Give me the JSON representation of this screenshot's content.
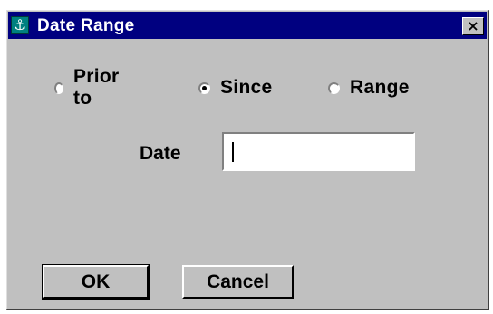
{
  "window": {
    "title": "Date Range",
    "icon": "anchor-icon",
    "icon_glyph": "⚓",
    "close_glyph": "×"
  },
  "radios": [
    {
      "label": "Prior to",
      "selected": false
    },
    {
      "label": "Since",
      "selected": true
    },
    {
      "label": "Range",
      "selected": false
    }
  ],
  "date": {
    "label": "Date",
    "value": "",
    "placeholder": ""
  },
  "buttons": {
    "ok_label": "OK",
    "cancel_label": "Cancel"
  },
  "colors": {
    "titlebar": "#000080",
    "face": "#c0c0c0",
    "icon_bg": "#008080"
  }
}
